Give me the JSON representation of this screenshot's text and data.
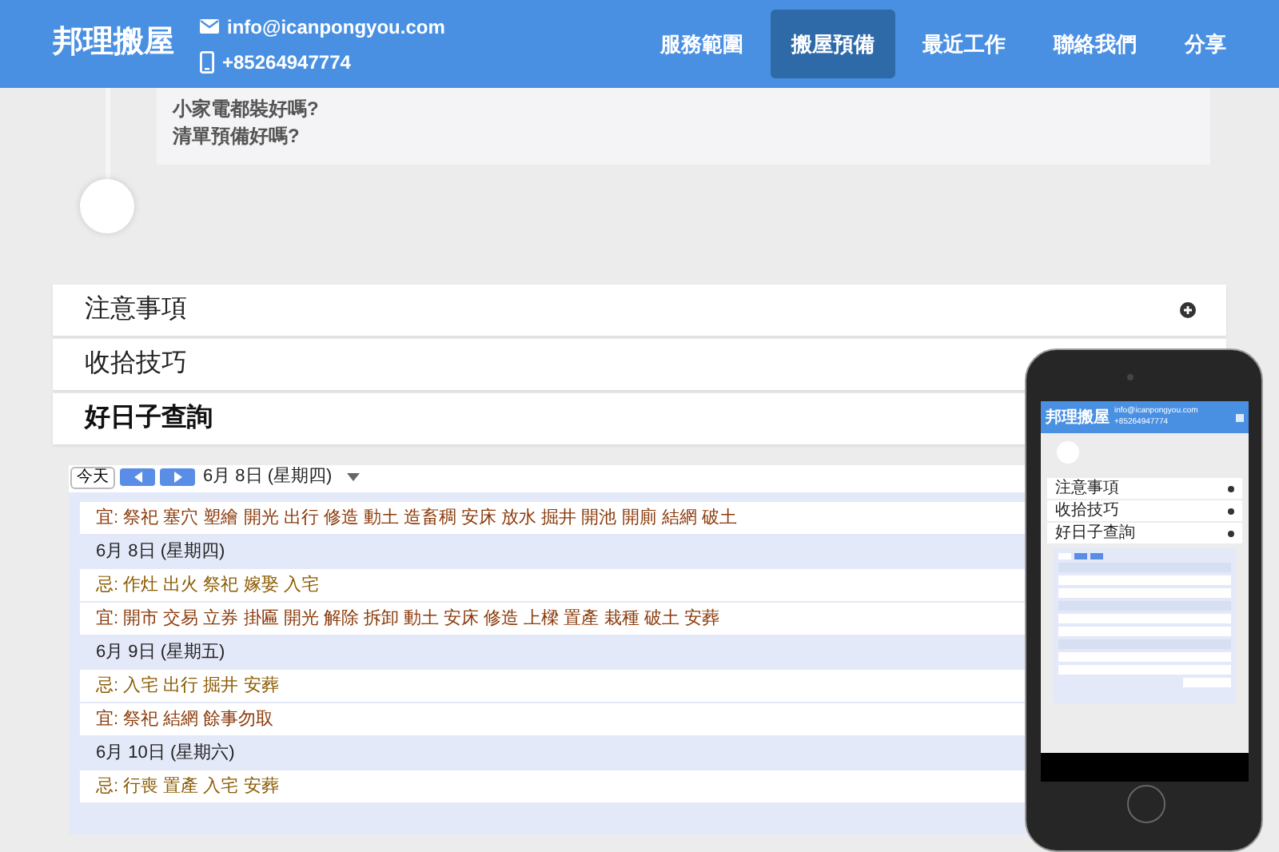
{
  "header": {
    "brand": "邦理搬屋",
    "email": "info@icanpongyou.com",
    "phone": "+85264947774",
    "nav": [
      {
        "label": "服務範圍",
        "selected": false
      },
      {
        "label": "搬屋預備",
        "selected": true
      },
      {
        "label": "最近工作",
        "selected": false
      },
      {
        "label": "聯絡我們",
        "selected": false
      },
      {
        "label": "分享",
        "selected": false
      }
    ]
  },
  "checklist": [
    "小家電都裝好嗎?",
    "清單預備好嗎?"
  ],
  "accordion": [
    {
      "label": "注意事項",
      "expanded": false
    },
    {
      "label": "收拾技巧",
      "expanded": false
    },
    {
      "label": "好日子查詢",
      "expanded": true
    }
  ],
  "calendar": {
    "today": "今天",
    "date": "6月 8日 (星期四)",
    "rows": [
      {
        "kind": "yi",
        "text": "宜: 祭祀 塞穴 塑繪 開光 出行 修造 動土 造畜稠 安床 放水 掘井 開池 開廁 結網 破土"
      },
      {
        "kind": "date",
        "text": "6月 8日 (星期四)"
      },
      {
        "kind": "ji",
        "text": "忌: 作灶 出火 祭祀 嫁娶 入宅"
      },
      {
        "kind": "yi",
        "text": "宜: 開市 交易 立券 掛匾 開光 解除 拆卸 動土 安床 修造 上樑 置產 栽種 破土 安葬"
      },
      {
        "kind": "date",
        "text": "6月 9日 (星期五)"
      },
      {
        "kind": "ji",
        "text": "忌: 入宅 出行 掘井 安葬"
      },
      {
        "kind": "yi",
        "text": "宜: 祭祀 結網 餘事勿取"
      },
      {
        "kind": "date",
        "text": "6月 10日 (星期六)"
      },
      {
        "kind": "ji",
        "text": "忌: 行喪 置產 入宅 安葬"
      }
    ]
  },
  "phone_preview": {
    "brand": "邦理搬屋",
    "email": "info@icanpongyou.com",
    "phone": "+85264947774",
    "accordion": [
      "注意事項",
      "收拾技巧",
      "好日子查詢"
    ]
  }
}
